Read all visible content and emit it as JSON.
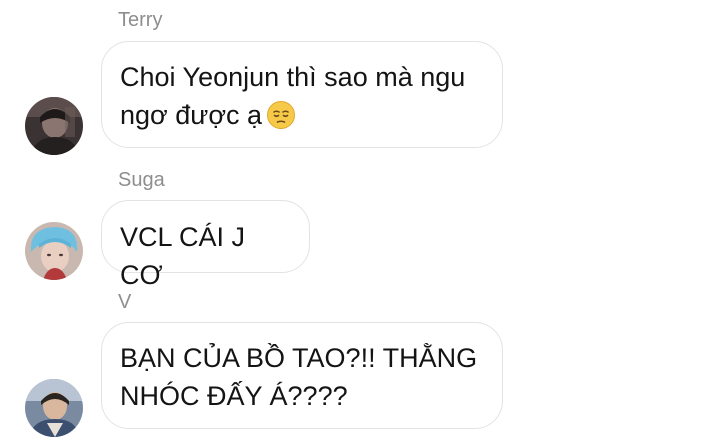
{
  "messages": [
    {
      "sender": "Terry",
      "text_line1": "Choi Yeonjun thì sao mà ngu",
      "text_line2": "ngơ được ạ",
      "emoji": "pensive-face-emoji"
    },
    {
      "sender": "Suga",
      "text": "VCL CÁI J CƠ"
    },
    {
      "sender": "V",
      "text_line1": "BẠN CỦA BỒ TAO?!! THẰNG",
      "text_line2": "NHÓC ĐẤY Á????"
    }
  ],
  "colors": {
    "sender_name": "#8e8e8e",
    "bubble_border": "#e3e3e3",
    "text": "#141414",
    "background": "#ffffff"
  }
}
